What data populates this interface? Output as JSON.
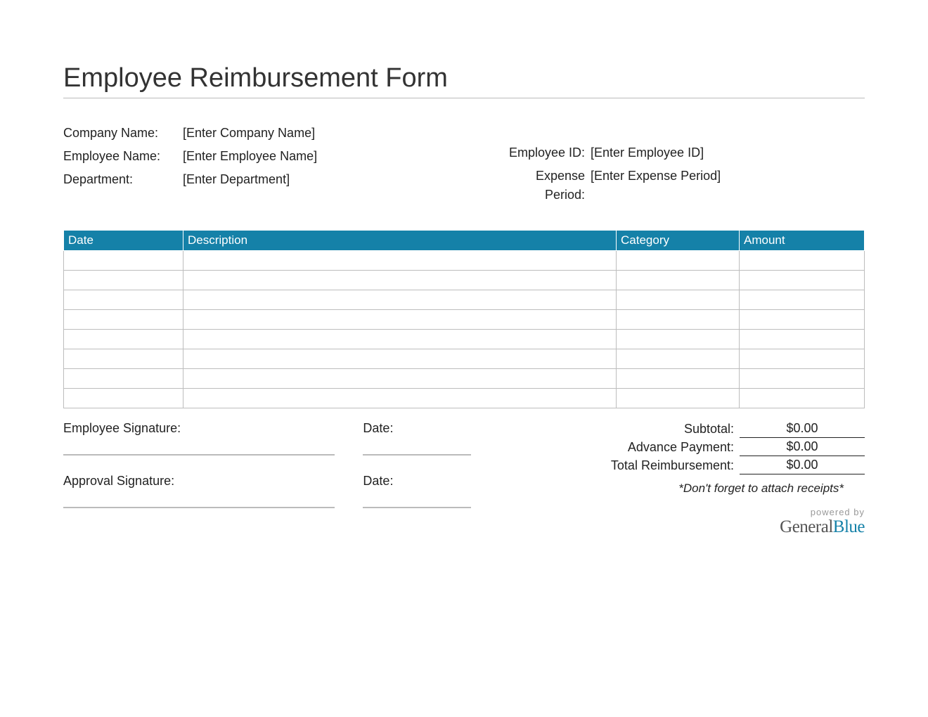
{
  "title": "Employee Reimbursement Form",
  "fields": {
    "company_label": "Company Name:",
    "company_value": "[Enter Company Name]",
    "employee_label": "Employee Name:",
    "employee_value": "[Enter Employee Name]",
    "department_label": "Department:",
    "department_value": "[Enter Department]",
    "empid_label": "Employee ID:",
    "empid_value": "[Enter Employee ID]",
    "period_label": "Expense Period:",
    "period_value": "[Enter Expense Period]"
  },
  "table": {
    "headers": {
      "date": "Date",
      "desc": "Description",
      "cat": "Category",
      "amt": "Amount"
    },
    "row_count": 8
  },
  "signatures": {
    "emp_sig": "Employee Signature:",
    "date": "Date:",
    "appr_sig": "Approval Signature:"
  },
  "totals": {
    "subtotal_label": "Subtotal:",
    "subtotal_value": "$0.00",
    "advance_label": "Advance Payment:",
    "advance_value": "$0.00",
    "total_label": "Total Reimbursement:",
    "total_value": "$0.00"
  },
  "note": "*Don't forget to attach receipts*",
  "brand": {
    "top": "powered by",
    "part1": "General",
    "part2": "Blue"
  }
}
